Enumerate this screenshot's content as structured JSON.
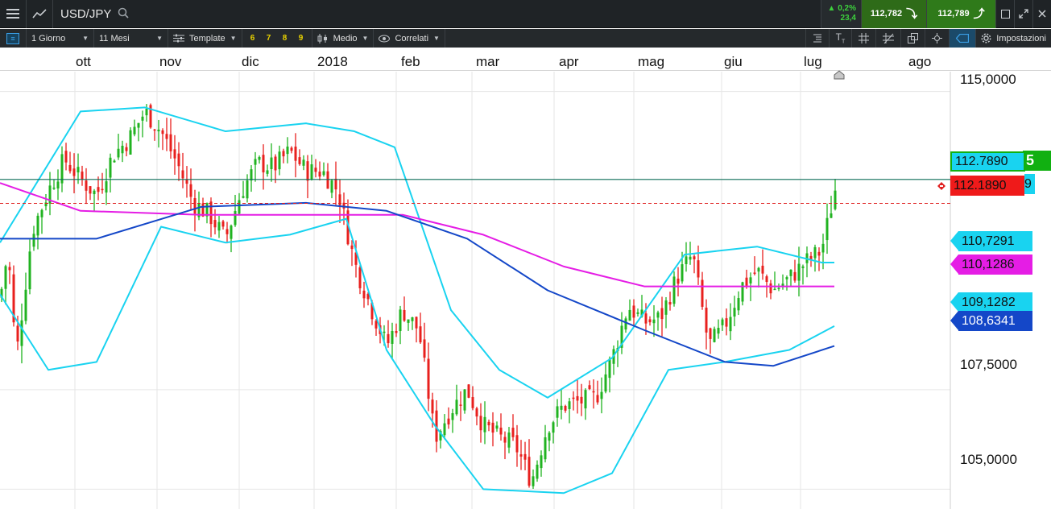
{
  "header": {
    "symbol": "USD/JPY",
    "change_percent": "▲ 0,2%",
    "change_points": "23,4",
    "sell_price": "112,782",
    "buy_price": "112,789"
  },
  "toolbar": {
    "timeframe": "1 Giorno",
    "range": "11 Mesi",
    "template": "Template",
    "presets": [
      "6",
      "7",
      "8",
      "9"
    ],
    "chart_style": "Medio",
    "correlated": "Correlati",
    "settings": "Impostazioni"
  },
  "colors": {
    "up_bar": "#21b321",
    "down_bar": "#e8201e",
    "bollinger": "#19d3f0",
    "ma_blue": "#1447c8",
    "ma_magenta": "#e51de5",
    "price_line": "#0a6b57"
  },
  "axis": {
    "months": [
      "ott",
      "nov",
      "dic",
      "2018",
      "feb",
      "mar",
      "apr",
      "mag",
      "giu",
      "lug",
      "ago"
    ],
    "y_labels": [
      "115,0000",
      "107,5000",
      "105,0000"
    ]
  },
  "badges": {
    "current_price": "112.7890",
    "reference_price": "112.1890",
    "boll_upper": "110,7291",
    "ma_magenta": "110,1286",
    "boll_lower": "109,1282",
    "ma_blue": "108,6341",
    "hidden_tail_1": "5",
    "hidden_tail_2": "9"
  },
  "chart_data": {
    "type": "candlestick",
    "pair": "USD/JPY",
    "timeframe": "daily",
    "ylim": [
      104.5,
      115.5
    ],
    "series": [
      {
        "name": "price",
        "points": [
          [
            0,
            109.8
          ],
          [
            10,
            111.0
          ],
          [
            20,
            108.3
          ],
          [
            40,
            111.5
          ],
          [
            60,
            112.5
          ],
          [
            80,
            113.3
          ],
          [
            100,
            112.8
          ],
          [
            120,
            112.4
          ],
          [
            140,
            113.4
          ],
          [
            160,
            113.8
          ],
          [
            180,
            114.5
          ],
          [
            200,
            114.0
          ],
          [
            220,
            113.2
          ],
          [
            240,
            112.2
          ],
          [
            260,
            111.9
          ],
          [
            280,
            111.3
          ],
          [
            300,
            112.5
          ],
          [
            320,
            113.2
          ],
          [
            340,
            113.1
          ],
          [
            360,
            113.5
          ],
          [
            380,
            113.0
          ],
          [
            400,
            113.0
          ],
          [
            420,
            112.5
          ],
          [
            440,
            110.7
          ],
          [
            460,
            109.6
          ],
          [
            480,
            108.6
          ],
          [
            500,
            109.5
          ],
          [
            520,
            109.0
          ],
          [
            540,
            106.3
          ],
          [
            560,
            107.0
          ],
          [
            580,
            107.5
          ],
          [
            600,
            106.6
          ],
          [
            620,
            106.3
          ],
          [
            640,
            106.1
          ],
          [
            660,
            105.2
          ],
          [
            680,
            106.6
          ],
          [
            700,
            107.1
          ],
          [
            720,
            107.2
          ],
          [
            740,
            107.3
          ],
          [
            760,
            108.3
          ],
          [
            780,
            109.6
          ],
          [
            800,
            109.2
          ],
          [
            820,
            109.3
          ],
          [
            840,
            110.3
          ],
          [
            860,
            110.9
          ],
          [
            880,
            108.6
          ],
          [
            900,
            109.1
          ],
          [
            920,
            110.1
          ],
          [
            940,
            110.5
          ],
          [
            960,
            110.0
          ],
          [
            980,
            110.3
          ],
          [
            1000,
            110.7
          ],
          [
            1020,
            111.0
          ],
          [
            1040,
            112.8
          ]
        ]
      },
      {
        "name": "bollinger-upper",
        "points": [
          [
            0,
            111.2
          ],
          [
            100,
            114.5
          ],
          [
            180,
            114.6
          ],
          [
            280,
            114.0
          ],
          [
            380,
            114.2
          ],
          [
            440,
            114.0
          ],
          [
            490,
            113.6
          ],
          [
            560,
            109.5
          ],
          [
            620,
            108.0
          ],
          [
            680,
            107.3
          ],
          [
            760,
            108.3
          ],
          [
            850,
            110.9
          ],
          [
            940,
            111.1
          ],
          [
            1020,
            110.7
          ],
          [
            1036,
            110.7
          ]
        ]
      },
      {
        "name": "bollinger-lower",
        "points": [
          [
            0,
            109.9
          ],
          [
            60,
            108.0
          ],
          [
            120,
            108.2
          ],
          [
            200,
            111.6
          ],
          [
            280,
            111.2
          ],
          [
            360,
            111.4
          ],
          [
            430,
            111.8
          ],
          [
            480,
            108.5
          ],
          [
            540,
            106.6
          ],
          [
            600,
            105.0
          ],
          [
            700,
            104.9
          ],
          [
            760,
            105.4
          ],
          [
            830,
            108.0
          ],
          [
            900,
            108.2
          ],
          [
            980,
            108.5
          ],
          [
            1036,
            109.1
          ]
        ]
      },
      {
        "name": "ma-magenta",
        "points": [
          [
            0,
            112.7
          ],
          [
            100,
            112.0
          ],
          [
            250,
            111.9
          ],
          [
            400,
            111.9
          ],
          [
            500,
            111.9
          ],
          [
            600,
            111.4
          ],
          [
            700,
            110.6
          ],
          [
            800,
            110.1
          ],
          [
            900,
            110.1
          ],
          [
            1036,
            110.1
          ]
        ]
      },
      {
        "name": "ma-blue",
        "points": [
          [
            0,
            111.3
          ],
          [
            120,
            111.3
          ],
          [
            250,
            112.1
          ],
          [
            380,
            112.2
          ],
          [
            480,
            112.0
          ],
          [
            580,
            111.3
          ],
          [
            680,
            110.0
          ],
          [
            800,
            109.0
          ],
          [
            900,
            108.2
          ],
          [
            960,
            108.1
          ],
          [
            1036,
            108.6
          ]
        ]
      }
    ]
  }
}
